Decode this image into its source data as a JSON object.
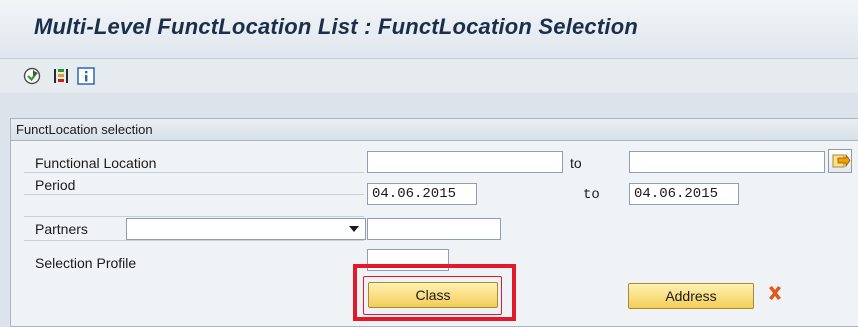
{
  "window": {
    "title": "Multi-Level FunctLocation List : FunctLocation Selection"
  },
  "toolbar": {
    "icons": [
      "execute-icon",
      "hierarchy-list-icon",
      "info-icon"
    ]
  },
  "panel": {
    "title": "FunctLocation selection",
    "rows": {
      "functional_location": {
        "label": "Functional Location",
        "from_value": "",
        "to_label": "to",
        "to_value": ""
      },
      "period": {
        "label": "Period",
        "from_value": "04.06.2015",
        "to_label": "to",
        "to_value": "04.06.2015"
      },
      "partners": {
        "label": "Partners",
        "select_value": "",
        "value": ""
      },
      "selection_profile": {
        "label": "Selection Profile",
        "value": ""
      }
    },
    "buttons": {
      "class_label": "Class",
      "address_label": "Address"
    }
  },
  "colors": {
    "highlight": "#e2192a",
    "button_gold": "#f4cd58",
    "title_text": "#1c2f4a"
  }
}
